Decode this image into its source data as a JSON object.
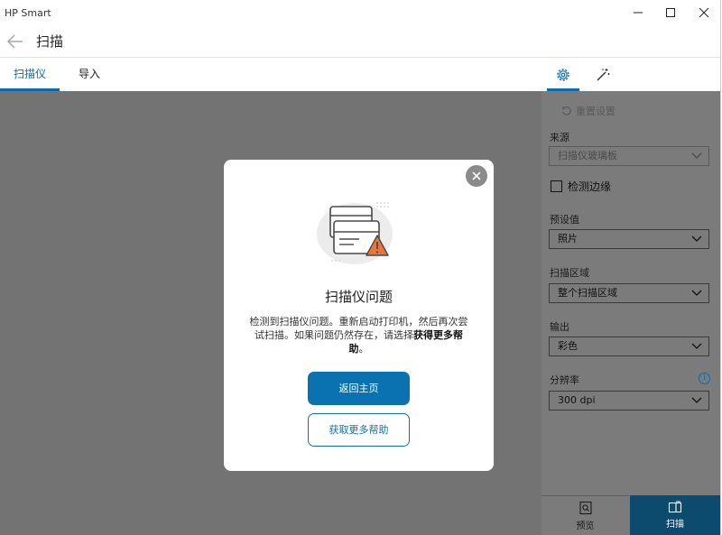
{
  "window": {
    "app_title": "HP Smart"
  },
  "header": {
    "title": "扫描"
  },
  "tabs": [
    {
      "label": "扫描仪",
      "active": true
    },
    {
      "label": "导入",
      "active": false
    }
  ],
  "panel": {
    "reset_label": "重置设置",
    "source": {
      "label": "来源",
      "value": "扫描仪玻璃板"
    },
    "detect_edges": {
      "label": "检测边缘",
      "checked": false
    },
    "preset": {
      "label": "预设值",
      "value": "照片"
    },
    "scan_area": {
      "label": "扫描区域",
      "value": "整个扫描区域"
    },
    "output": {
      "label": "输出",
      "value": "彩色"
    },
    "resolution": {
      "label": "分辨率",
      "value": "300 dpi",
      "info_icon": "i"
    },
    "preview_label": "预览",
    "scan_label": "扫描"
  },
  "modal": {
    "title": "扫描仪问题",
    "body_text": "检测到扫描仪问题。重新启动打印机，然后再次尝试扫描。如果问题仍然存在，请选择",
    "body_bold": "获得更多帮助",
    "body_end": "。",
    "primary_button": "返回主页",
    "secondary_button": "获取更多帮助"
  },
  "colors": {
    "accent": "#0a72b0",
    "overlay": "#737373",
    "warning": "#e8763a",
    "scan_button_bg": "#0c4a6e"
  }
}
